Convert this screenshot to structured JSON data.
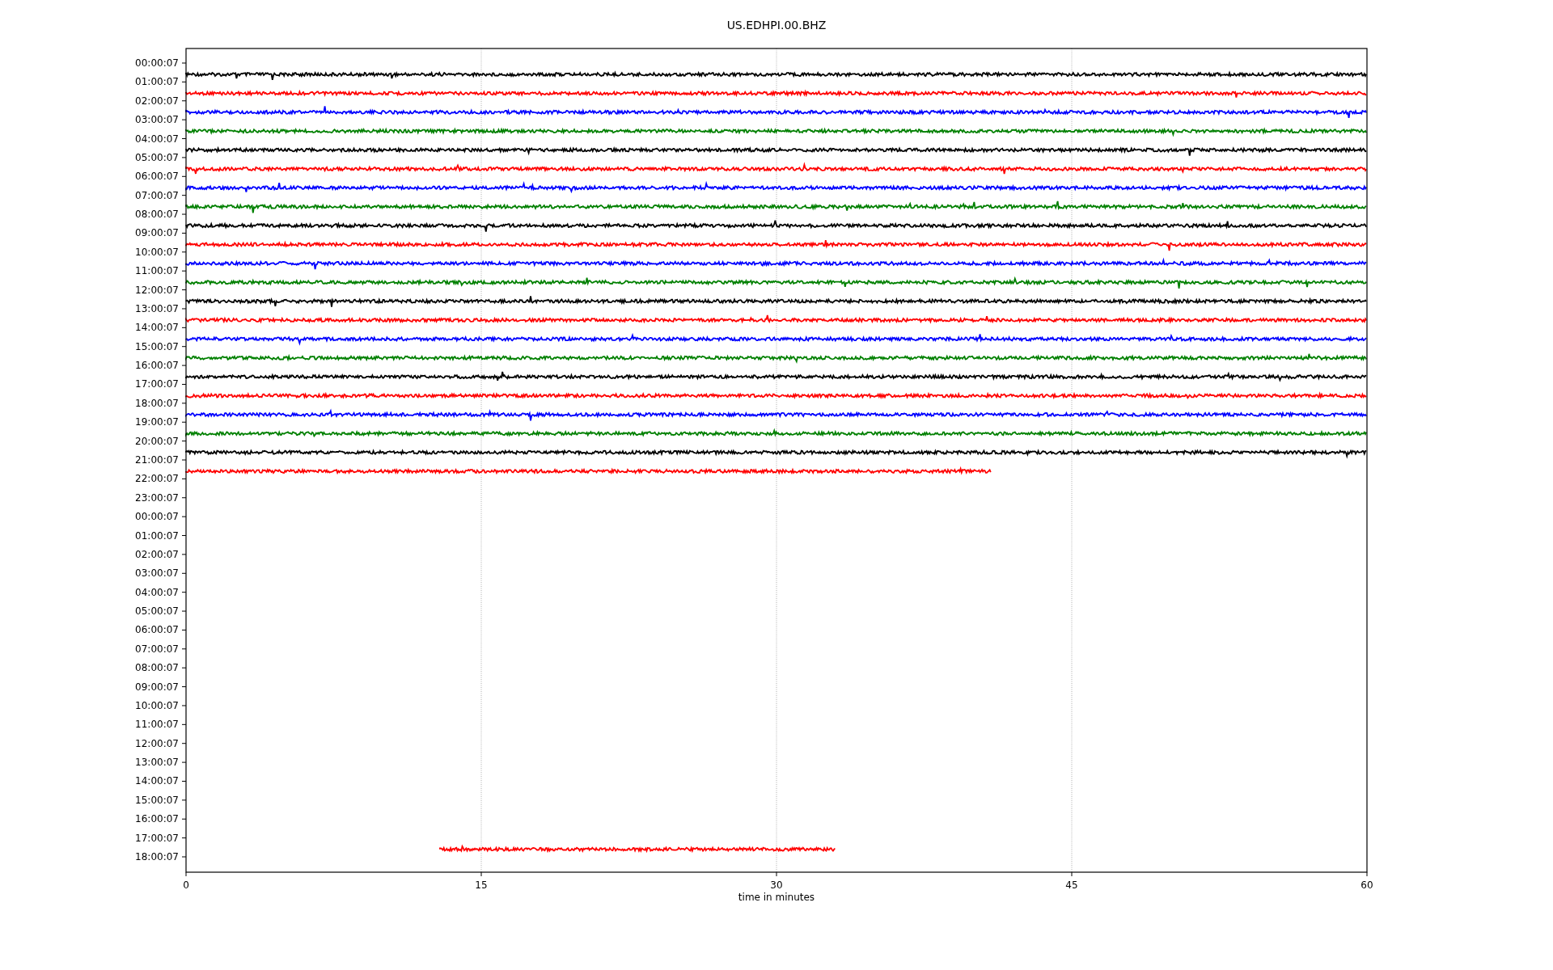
{
  "figure": {
    "title": "US.EDHPI.00.BHZ",
    "x_axis": {
      "label": "time in minutes",
      "ticks": [
        "0",
        "15",
        "30",
        "45",
        "60"
      ]
    },
    "rows": [
      {
        "label": "00:00:07",
        "trace": {
          "color": "#000000",
          "segments": [
            {
              "kind": "signal",
              "level": 1
            }
          ]
        }
      },
      {
        "label": "01:00:07",
        "trace": {
          "color": "#ff0000",
          "segments": [
            {
              "kind": "signal",
              "level": 1
            }
          ]
        }
      },
      {
        "label": "02:00:07",
        "trace": {
          "color": "#0000ff",
          "segments": [
            {
              "kind": "signal",
              "level": 1
            }
          ]
        }
      },
      {
        "label": "03:00:07",
        "trace": {
          "color": "#008000",
          "segments": [
            {
              "kind": "signal",
              "level": 1
            }
          ]
        }
      },
      {
        "label": "04:00:07",
        "trace": {
          "color": "#000000",
          "segments": [
            {
              "kind": "signal",
              "level": 1
            }
          ]
        }
      },
      {
        "label": "05:00:07",
        "trace": {
          "color": "#ff0000",
          "segments": [
            {
              "kind": "signal",
              "level": 1
            }
          ]
        }
      },
      {
        "label": "06:00:07",
        "trace": {
          "color": "#0000ff",
          "segments": [
            {
              "kind": "signal",
              "level": 1
            }
          ]
        }
      },
      {
        "label": "07:00:07",
        "trace": {
          "color": "#008000",
          "segments": [
            {
              "kind": "signal",
              "level": 1
            }
          ]
        }
      },
      {
        "label": "08:00:07",
        "trace": {
          "color": "#000000",
          "segments": [
            {
              "kind": "signal",
              "level": 1
            }
          ]
        }
      },
      {
        "label": "09:00:07",
        "trace": {
          "color": "#ff0000",
          "segments": [
            {
              "kind": "signal",
              "level": 1
            }
          ]
        }
      },
      {
        "label": "10:00:07",
        "trace": {
          "color": "#0000ff",
          "segments": [
            {
              "kind": "signal",
              "level": 1
            }
          ]
        }
      },
      {
        "label": "11:00:07",
        "trace": {
          "color": "#008000",
          "segments": [
            {
              "kind": "signal",
              "level": 1
            }
          ]
        }
      },
      {
        "label": "12:00:07",
        "trace": {
          "color": "#000000",
          "segments": [
            {
              "kind": "signal",
              "level": 1
            }
          ]
        }
      },
      {
        "label": "13:00:07",
        "trace": {
          "color": "#ff0000",
          "segments": [
            {
              "kind": "signal",
              "level": 1
            }
          ]
        }
      },
      {
        "label": "14:00:07",
        "trace": {
          "color": "#0000ff",
          "segments": [
            {
              "kind": "signal",
              "level": 1
            }
          ]
        }
      },
      {
        "label": "15:00:07",
        "trace": {
          "color": "#008000",
          "segments": [
            {
              "kind": "signal",
              "level": 1
            }
          ]
        }
      },
      {
        "label": "16:00:07",
        "trace": {
          "color": "#000000",
          "segments": [
            {
              "kind": "signal",
              "level": 1
            }
          ]
        }
      },
      {
        "label": "17:00:07",
        "trace": {
          "color": "#ff0000",
          "segments": [
            {
              "kind": "signal",
              "level": 1
            }
          ]
        }
      },
      {
        "label": "18:00:07",
        "trace": {
          "color": "#0000ff",
          "segments": [
            {
              "kind": "signal",
              "level": 1
            }
          ]
        }
      },
      {
        "label": "19:00:07",
        "trace": {
          "color": "#008000",
          "segments": [
            {
              "kind": "signal",
              "level": 1
            }
          ]
        }
      },
      {
        "label": "20:00:07",
        "trace": {
          "color": "#000000",
          "segments": [
            {
              "kind": "signal",
              "level": 1
            }
          ]
        }
      },
      {
        "label": "21:00:07",
        "trace": {
          "color": "#ff0000",
          "segments": [
            {
              "kind": "signal",
              "level": 0.682
            }
          ]
        }
      },
      {
        "label": "22:00:07"
      },
      {
        "label": "23:00:07"
      },
      {
        "label": "00:00:07"
      },
      {
        "label": "01:00:07"
      },
      {
        "label": "02:00:07"
      },
      {
        "label": "03:00:07"
      },
      {
        "label": "04:00:07"
      },
      {
        "label": "05:00:07"
      },
      {
        "label": "06:00:07"
      },
      {
        "label": "07:00:07"
      },
      {
        "label": "08:00:07"
      },
      {
        "label": "09:00:07"
      },
      {
        "label": "10:00:07"
      },
      {
        "label": "11:00:07"
      },
      {
        "label": "12:00:07"
      },
      {
        "label": "13:00:07"
      },
      {
        "label": "14:00:07"
      },
      {
        "label": "15:00:07"
      },
      {
        "label": "16:00:07"
      },
      {
        "label": "17:00:07",
        "trace": {
          "color": "#ff0000",
          "segments": [
            {
              "kind": "gap",
              "level": 0.215
            },
            {
              "kind": "signal",
              "level": 0.335
            }
          ]
        }
      },
      {
        "label": "18:00:07"
      }
    ]
  }
}
